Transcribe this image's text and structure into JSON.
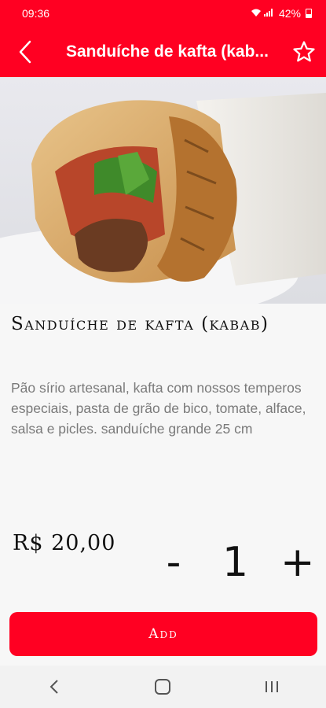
{
  "status_bar": {
    "time": "09:36",
    "icons": "wifi-icon signal-icon",
    "battery": "42%"
  },
  "app_bar": {
    "title": "Sanduíche de kafta (kab...",
    "back_icon": "chevron-left-icon",
    "favorite_icon": "star-outline-icon"
  },
  "product": {
    "name": "Sanduíche de kafta (kabab)",
    "description": "Pão sírio artesanal, kafta com nossos temperos especiais, pasta de grão de bico, tomate, alface, salsa e picles. sanduíche grande 25 cm",
    "price": "R$ 20,00",
    "image": "kafta-wrap-photo"
  },
  "quantity": {
    "minus_label": "-",
    "value": "1",
    "plus_label": "+"
  },
  "actions": {
    "add_label": "Add"
  },
  "colors": {
    "brand_red": "#ff0022",
    "background": "#f7f7f7",
    "description_text": "#7a7a7a"
  },
  "nav_bar": {
    "back_icon": "nav-back-icon",
    "home_icon": "nav-home-icon",
    "recents_icon": "nav-recents-icon"
  }
}
